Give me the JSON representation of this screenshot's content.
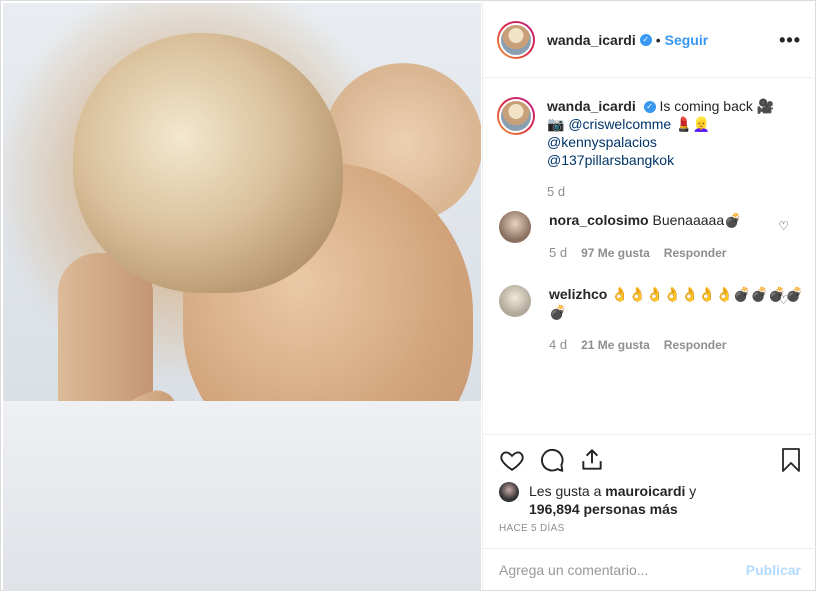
{
  "post": {
    "author": "wanda_icardi",
    "follow_label": "Seguir",
    "separator": "•",
    "more_label": "•••"
  },
  "caption": {
    "author": "wanda_icardi",
    "text": "Is coming back 🎥",
    "line2_prefix": "📷 ",
    "mention1": "@criswelcomme",
    "line2_suffix": " 💄👱‍♀️",
    "mention2": "@kennyspalacios",
    "mention3": "@137pillarsbangkok",
    "age": "5 d"
  },
  "comments": [
    {
      "user": "nora_colosimo",
      "text": "Buenaaaaa💣",
      "age": "5 d",
      "likes": "97 Me gusta",
      "reply": "Responder"
    },
    {
      "user": "welizhco",
      "text": "👌👌👌👌👌👌👌💣💣💣💣💣",
      "age": "4 d",
      "likes": "21 Me gusta",
      "reply": "Responder"
    }
  ],
  "likes": {
    "prefix": "Les gusta a ",
    "friend": "mauroicardi",
    "connector": " y",
    "count": "196,894 personas más"
  },
  "timestamp": "HACE 5 DÍAS",
  "comment_box": {
    "placeholder": "Agrega un comentario...",
    "publish_label": "Publicar"
  },
  "icons": {
    "verified": "✓",
    "heart_small": "♡"
  },
  "colors": {
    "accent": "#3897f0",
    "publish_disabled": "#b3dbff",
    "muted": "#8e8e8e"
  }
}
